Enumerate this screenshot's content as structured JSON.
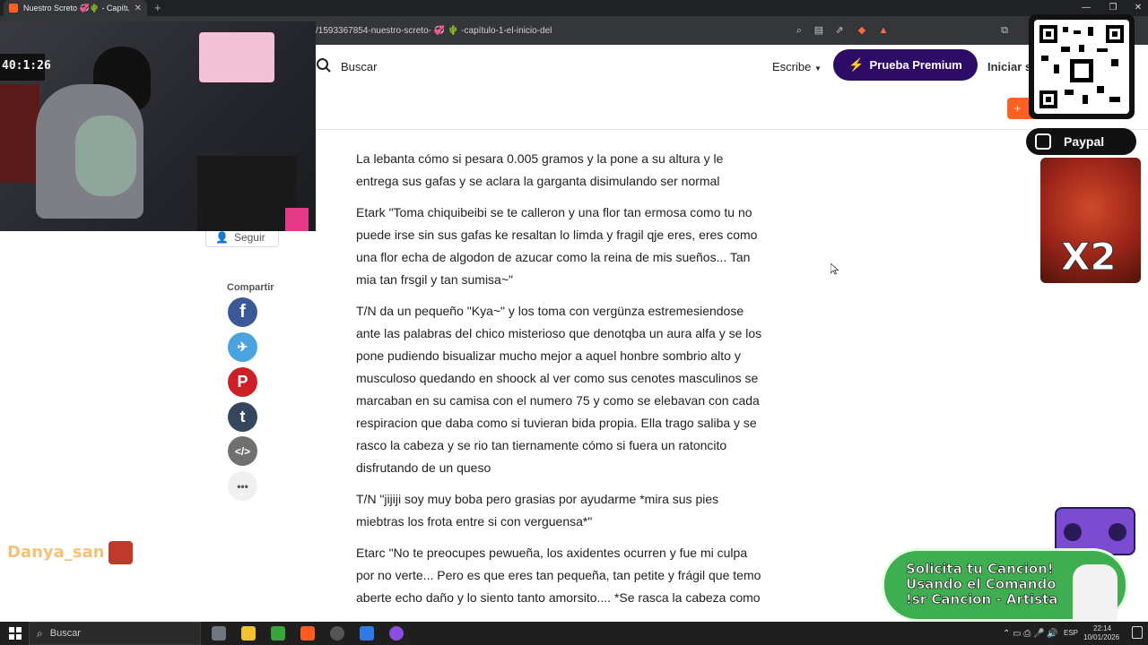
{
  "browser": {
    "tab_title": "Nuestro Screto 💞🌵 - Capítulo",
    "url": "/1593367854-nuestro-screto- 💞 🌵 -capítulo-1-el-inicio-del"
  },
  "header": {
    "search_label": "Buscar",
    "write_label": "Escribe",
    "premium_label": "Prueba Premium",
    "login_label": "Iniciar s",
    "orange_button_label": "+"
  },
  "sidebar": {
    "follow_label": "Seguir",
    "share_title": "Compartir",
    "share_buttons": [
      {
        "icon": "facebook-icon",
        "glyph": "f",
        "color": "#3b5998"
      },
      {
        "icon": "twitter-icon",
        "glyph": "🐦",
        "color": "#4aa3df"
      },
      {
        "icon": "pinterest-icon",
        "glyph": "P",
        "color": "#cb2027"
      },
      {
        "icon": "tumblr-icon",
        "glyph": "t",
        "color": "#36465d"
      },
      {
        "icon": "embed-icon",
        "glyph": "</>",
        "color": "#707070"
      },
      {
        "icon": "more-icon",
        "glyph": "•••",
        "color": "#f0f0f0"
      }
    ]
  },
  "story": {
    "paragraphs": [
      "La lebanta cómo si pesara 0.005 gramos y la pone a su altura y le entrega sus gafas y se aclara la garganta disimulando ser normal",
      "Etark \"Toma chiquibeibi se te calleron y una flor tan ermosa como tu no puede irse sin sus gafas ke resaltan lo limda y fragil qje eres, eres como una flor echa de algodon de azucar como la reina de mis sueños... Tan mia tan frsgil y tan sumisa~\"",
      "T/N da un pequeño \"Kya~\" y los toma con vergünza estremesiendose ante las palabras del chico misterioso que denotqba un aura alfa y se los pone pudiendo bisualizar mucho mejor a aquel honbre sombrio alto y musculoso quedando en shoock al ver como sus cenotes masculinos se marcaban en su camisa con el numero 75 y como se elebavan con cada respiracion que daba como si tuvieran bida propia. Ella trago saliba y se rasco la cabeza y se rio tan tiernamente cómo si fuera un ratoncito disfrutando de un queso",
      "T/N \"jijiji soy muy boba pero grasias por ayudarme *mira sus pies miebtras los frota entre si con verguensa*\"",
      "Etarc \"No te preocupes pewueña, los axidentes ocurren y fue mi culpa por no verte... Pero es que eres tan pequeña, tan petite y frágil que temo aberte echo daño y lo siento tanto amorsito.... *Se rasca la cabeza como"
    ]
  },
  "overlay": {
    "webcam_clock": "40:1:26",
    "paypal_label": "Paypal",
    "meme_label": "X2",
    "chat_username": "Danya_san",
    "song_banner": [
      "Solicita tu Cancion!",
      "Usando el Comando",
      "!sr Cancion - Artista"
    ]
  },
  "taskbar": {
    "search_label": "Buscar",
    "lang": "ESP",
    "time": "22:14",
    "date": "10/01/2026"
  }
}
